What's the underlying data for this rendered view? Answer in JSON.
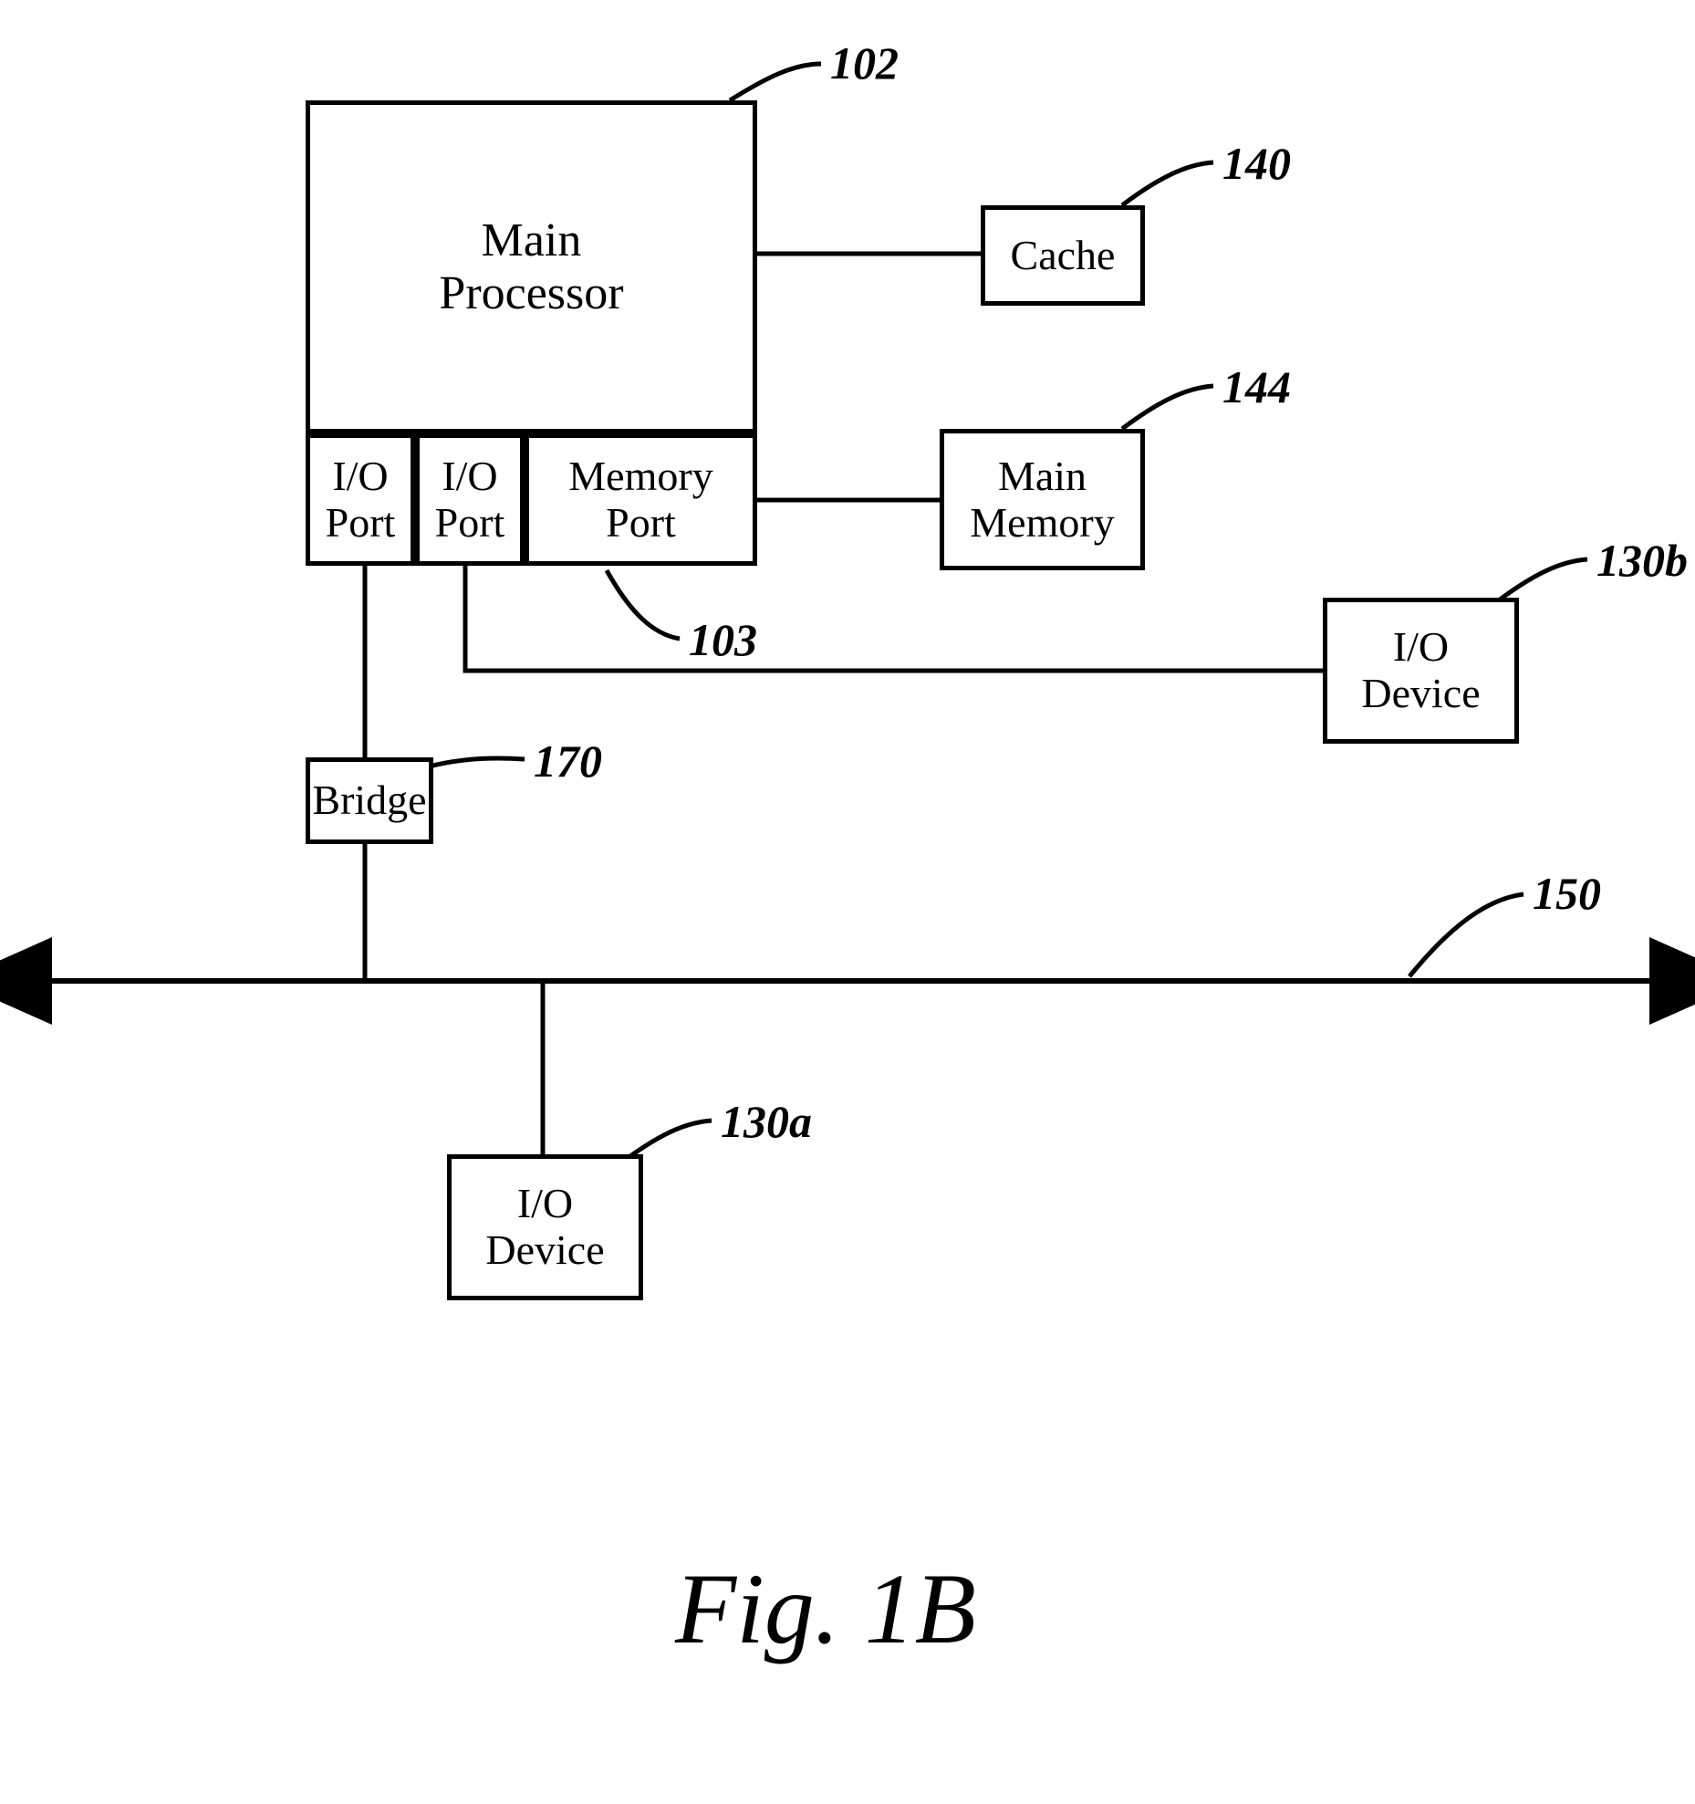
{
  "figure_caption": "Fig. 1B",
  "blocks": {
    "main_processor": "Main\nProcessor",
    "io_port_1": "I/O\nPort",
    "io_port_2": "I/O\nPort",
    "memory_port": "Memory\nPort",
    "cache": "Cache",
    "main_memory": "Main\nMemory",
    "bridge": "Bridge",
    "io_device_a": "I/O\nDevice",
    "io_device_b": "I/O\nDevice"
  },
  "refs": {
    "main_processor": "102",
    "memory_port": "103",
    "cache": "140",
    "main_memory": "144",
    "bridge": "170",
    "bus": "150",
    "io_device_a": "130a",
    "io_device_b": "130b"
  }
}
